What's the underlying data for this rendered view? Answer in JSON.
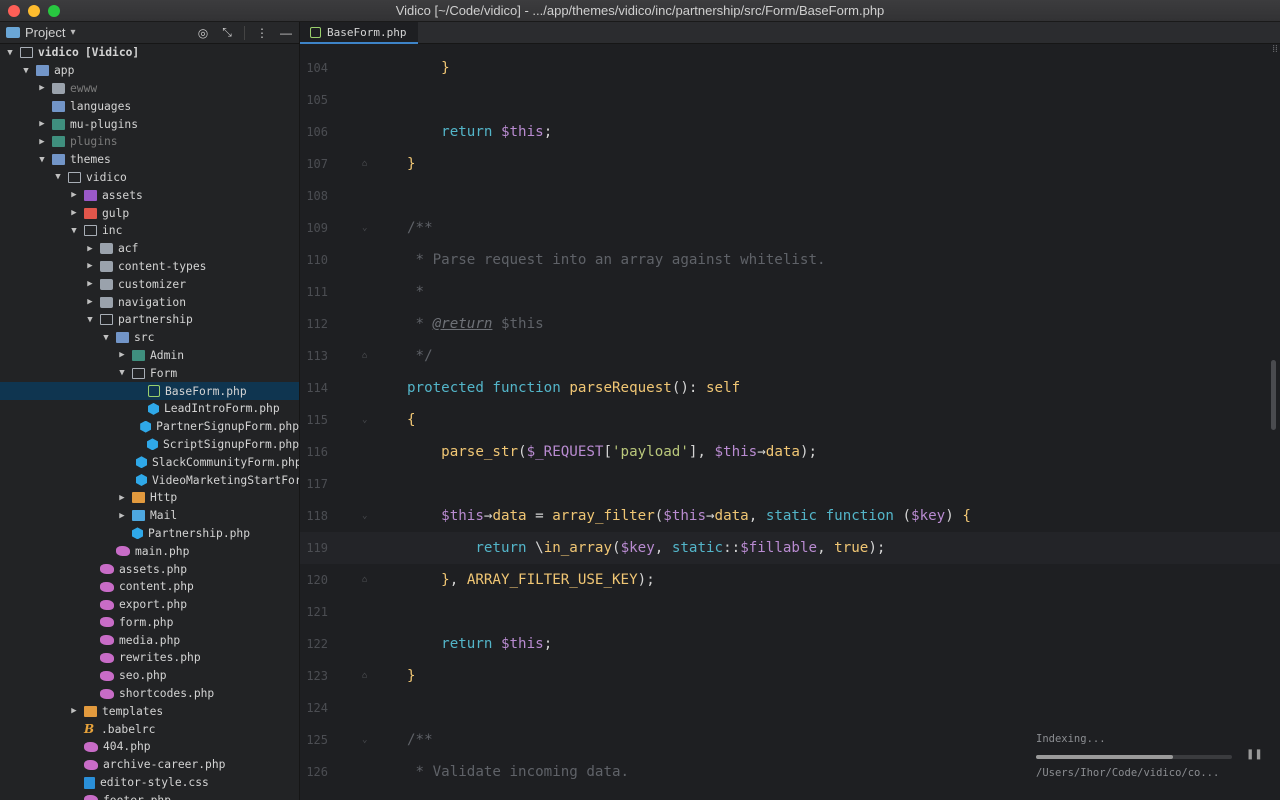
{
  "window": {
    "title": "Vidico [~/Code/vidico] - .../app/themes/vidico/inc/partnership/src/Form/BaseForm.php"
  },
  "project_panel": {
    "title": "Project",
    "tools": [
      "target-icon",
      "collapse-icon",
      "more-icon",
      "minimize-icon"
    ]
  },
  "tree": [
    {
      "depth": 0,
      "arrow": "▼",
      "icon": "folder-open",
      "label": "vidico",
      "extra": "[Vidico]"
    },
    {
      "depth": 1,
      "arrow": "▼",
      "icon": "folder-blue",
      "label": "app"
    },
    {
      "depth": 2,
      "arrow": "▶",
      "icon": "folder",
      "label": "ewww",
      "dim": true
    },
    {
      "depth": 2,
      "arrow": "",
      "icon": "folder-blue",
      "label": "languages"
    },
    {
      "depth": 2,
      "arrow": "▶",
      "icon": "folder-green",
      "label": "mu-plugins"
    },
    {
      "depth": 2,
      "arrow": "▶",
      "icon": "folder-green",
      "label": "plugins",
      "dim": true
    },
    {
      "depth": 2,
      "arrow": "▼",
      "icon": "folder-blue",
      "label": "themes"
    },
    {
      "depth": 3,
      "arrow": "▼",
      "icon": "folder-open",
      "label": "vidico"
    },
    {
      "depth": 4,
      "arrow": "▶",
      "icon": "folder-purple",
      "label": "assets"
    },
    {
      "depth": 4,
      "arrow": "▶",
      "icon": "folder-red",
      "label": "gulp"
    },
    {
      "depth": 4,
      "arrow": "▼",
      "icon": "folder-open",
      "label": "inc"
    },
    {
      "depth": 5,
      "arrow": "▶",
      "icon": "folder",
      "label": "acf"
    },
    {
      "depth": 5,
      "arrow": "▶",
      "icon": "folder",
      "label": "content-types"
    },
    {
      "depth": 5,
      "arrow": "▶",
      "icon": "folder",
      "label": "customizer"
    },
    {
      "depth": 5,
      "arrow": "▶",
      "icon": "folder",
      "label": "navigation"
    },
    {
      "depth": 5,
      "arrow": "▼",
      "icon": "folder-open",
      "label": "partnership"
    },
    {
      "depth": 6,
      "arrow": "▼",
      "icon": "folder-blue",
      "label": "src"
    },
    {
      "depth": 7,
      "arrow": "▶",
      "icon": "folder-green",
      "label": "Admin"
    },
    {
      "depth": 7,
      "arrow": "▼",
      "icon": "folder-open",
      "label": "Form"
    },
    {
      "depth": 8,
      "arrow": "",
      "icon": "class-sel",
      "label": "BaseForm.php",
      "selected": true
    },
    {
      "depth": 8,
      "arrow": "",
      "icon": "class",
      "label": "LeadIntroForm.php"
    },
    {
      "depth": 8,
      "arrow": "",
      "icon": "class",
      "label": "PartnerSignupForm.php"
    },
    {
      "depth": 8,
      "arrow": "",
      "icon": "class",
      "label": "ScriptSignupForm.php"
    },
    {
      "depth": 8,
      "arrow": "",
      "icon": "class",
      "label": "SlackCommunityForm.php"
    },
    {
      "depth": 8,
      "arrow": "",
      "icon": "class",
      "label": "VideoMarketingStartFor"
    },
    {
      "depth": 7,
      "arrow": "▶",
      "icon": "folder-orange",
      "label": "Http"
    },
    {
      "depth": 7,
      "arrow": "▶",
      "icon": "folder-lightblue",
      "label": "Mail"
    },
    {
      "depth": 7,
      "arrow": "",
      "icon": "class",
      "label": "Partnership.php"
    },
    {
      "depth": 6,
      "arrow": "",
      "icon": "php",
      "label": "main.php"
    },
    {
      "depth": 5,
      "arrow": "",
      "icon": "php",
      "label": "assets.php"
    },
    {
      "depth": 5,
      "arrow": "",
      "icon": "php",
      "label": "content.php"
    },
    {
      "depth": 5,
      "arrow": "",
      "icon": "php",
      "label": "export.php"
    },
    {
      "depth": 5,
      "arrow": "",
      "icon": "php",
      "label": "form.php"
    },
    {
      "depth": 5,
      "arrow": "",
      "icon": "php",
      "label": "media.php"
    },
    {
      "depth": 5,
      "arrow": "",
      "icon": "php",
      "label": "rewrites.php"
    },
    {
      "depth": 5,
      "arrow": "",
      "icon": "php",
      "label": "seo.php"
    },
    {
      "depth": 5,
      "arrow": "",
      "icon": "php",
      "label": "shortcodes.php"
    },
    {
      "depth": 4,
      "arrow": "▶",
      "icon": "folder-orange",
      "label": "templates"
    },
    {
      "depth": 4,
      "arrow": "",
      "icon": "babel",
      "label": ".babelrc"
    },
    {
      "depth": 4,
      "arrow": "",
      "icon": "php",
      "label": "404.php"
    },
    {
      "depth": 4,
      "arrow": "",
      "icon": "php",
      "label": "archive-career.php"
    },
    {
      "depth": 4,
      "arrow": "",
      "icon": "css",
      "label": "editor-style.css"
    },
    {
      "depth": 4,
      "arrow": "",
      "icon": "php",
      "label": "footer.php"
    }
  ],
  "tab": {
    "label": "BaseForm.php"
  },
  "editor": {
    "current_line": 119,
    "lines": [
      {
        "n": "104",
        "fold": "",
        "html": "    <span class=\"br\">}</span>"
      },
      {
        "n": "105",
        "fold": "",
        "html": ""
      },
      {
        "n": "106",
        "fold": "",
        "html": "    <span class=\"kw\">return</span> <span class=\"var\">$this</span>;"
      },
      {
        "n": "107",
        "fold": "⌂",
        "html": "<span class=\"br\">}</span>"
      },
      {
        "n": "108",
        "fold": "",
        "html": ""
      },
      {
        "n": "109",
        "fold": "⌄",
        "html": "<span class=\"cm\">/**</span>"
      },
      {
        "n": "110",
        "fold": "",
        "html": "<span class=\"cm\"> * Parse request into an array against whitelist.</span>"
      },
      {
        "n": "111",
        "fold": "",
        "html": "<span class=\"cm\"> *</span>"
      },
      {
        "n": "112",
        "fold": "",
        "html": "<span class=\"cm\"> * </span><span class=\"tag\">@return</span><span class=\"cm\"> $this</span>"
      },
      {
        "n": "113",
        "fold": "⌂",
        "html": "<span class=\"cm\"> */</span>"
      },
      {
        "n": "114",
        "fold": "",
        "html": "<span class=\"kw\">protected</span> <span class=\"kw\">function</span> <span class=\"fn\">parseRequest</span>(): <span class=\"cls\">self</span>"
      },
      {
        "n": "115",
        "fold": "⌄",
        "html": "<span class=\"br\">{</span>"
      },
      {
        "n": "116",
        "fold": "",
        "html": "    <span class=\"fn\">parse_str</span>(<span class=\"var\">$_REQUEST</span>[<span class=\"str\">'payload'</span>], <span class=\"var\">$this</span><span class=\"op\">→</span><span class=\"fn\">data</span>);"
      },
      {
        "n": "117",
        "fold": "",
        "html": ""
      },
      {
        "n": "118",
        "fold": "⌄",
        "html": "    <span class=\"var\">$this</span><span class=\"op\">→</span><span class=\"fn\">data</span> = <span class=\"fn\">array_filter</span>(<span class=\"var\">$this</span><span class=\"op\">→</span><span class=\"fn\">data</span>, <span class=\"stat\">static</span> <span class=\"kw\">function</span> (<span class=\"var\">$key</span>) <span class=\"br\">{</span>"
      },
      {
        "n": "119",
        "fold": "",
        "html": "        <span class=\"kw\">return</span> \\<span class=\"fn\">in_array</span>(<span class=\"var\">$key</span>, <span class=\"stat\">static</span>::<span class=\"var\">$fillable</span>, <span class=\"con\">true</span>);"
      },
      {
        "n": "120",
        "fold": "⌂",
        "html": "    <span class=\"br\">}</span>, <span class=\"con\">ARRAY_FILTER_USE_KEY</span>);"
      },
      {
        "n": "121",
        "fold": "",
        "html": ""
      },
      {
        "n": "122",
        "fold": "",
        "html": "    <span class=\"kw\">return</span> <span class=\"var\">$this</span>;"
      },
      {
        "n": "123",
        "fold": "⌂",
        "html": "<span class=\"br\">}</span>"
      },
      {
        "n": "124",
        "fold": "",
        "html": ""
      },
      {
        "n": "125",
        "fold": "⌄",
        "html": "<span class=\"cm\">/**</span>"
      },
      {
        "n": "126",
        "fold": "",
        "html": "<span class=\"cm\"> * Validate incoming data.</span>"
      }
    ]
  },
  "indexing": {
    "label": "Indexing...",
    "progress": 0.7,
    "path": "/Users/Ihor/Code/vidico/co..."
  }
}
